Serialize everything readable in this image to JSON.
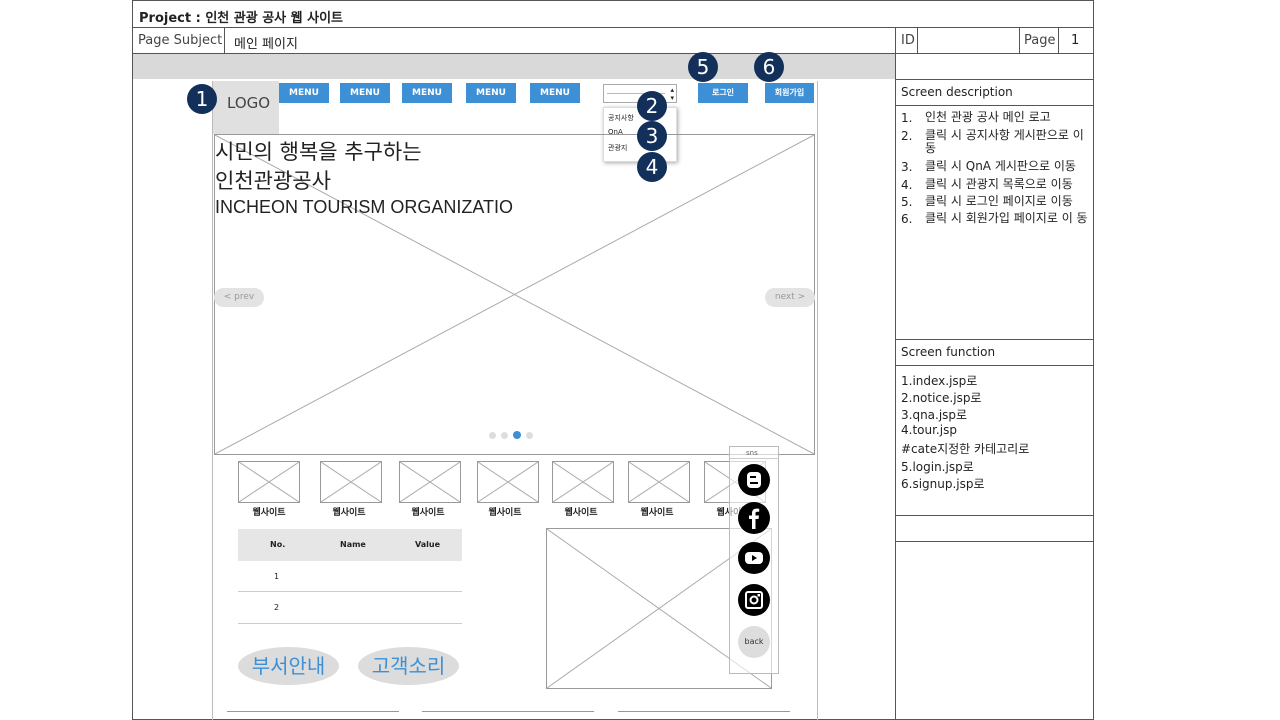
{
  "project": {
    "title": "Project : 인천 관광 공사 웹 사이트"
  },
  "subject": {
    "label": "Page Subject",
    "value": "메인 페이지",
    "id_label": "ID",
    "id_value": "",
    "page_label": "Page",
    "page_value": "1"
  },
  "header": {
    "logo": "LOGO",
    "menus": [
      "MENU",
      "MENU",
      "MENU",
      "MENU",
      "MENU"
    ],
    "login": "로그인",
    "signup": "회원가입"
  },
  "dropdown": {
    "items": [
      "공지사항",
      "QnA",
      "관광지"
    ]
  },
  "badges": [
    "1",
    "2",
    "3",
    "4",
    "5",
    "6"
  ],
  "hero": {
    "line1": "시민의 행복을 추구하는",
    "line2": "인천관광공사",
    "line3": "INCHEON TOURISM ORGANIZATIO",
    "prev": "< prev",
    "next": "next >",
    "dots": 4,
    "active_dot": 3
  },
  "sites": {
    "labels": [
      "웹사이트",
      "웹사이트",
      "웹사이트",
      "웹사이트",
      "웹사이트",
      "웹사이트",
      "웹사이트"
    ]
  },
  "table": {
    "headers": [
      "No.",
      "Name",
      "Value"
    ],
    "rows": [
      [
        "1",
        "",
        ""
      ],
      [
        "2",
        "",
        ""
      ]
    ]
  },
  "buttons": {
    "dept": "부서안내",
    "voice": "고객소리"
  },
  "sns": {
    "label": "sns",
    "icons": [
      "blogger-icon",
      "facebook-icon",
      "youtube-icon",
      "instagram-icon"
    ],
    "back": "back"
  },
  "description": {
    "title": "Screen description",
    "items": [
      {
        "num": "1.",
        "text": "인천 관광 공사 메인 로고"
      },
      {
        "num": "2.",
        "text": "클릭 시 공지사항 게시판으로 이동"
      },
      {
        "num": "3.",
        "text": "클릭 시 QnA 게시판으로 이동"
      },
      {
        "num": "4.",
        "text": "클릭 시 관광지 목록으로 이동"
      },
      {
        "num": "5.",
        "text": "클릭 시 로그인 페이지로 이동"
      },
      {
        "num": "6.",
        "text": "클릭 시 회원가입 페이지로 이 동"
      }
    ]
  },
  "function": {
    "title": "Screen function",
    "lines": [
      "1.index.jsp로",
      "2.notice.jsp로",
      "3.qna.jsp로",
      "4.tour.jsp",
      "#cate지정한 카테고리로",
      "5.login.jsp로",
      "6.signup.jsp로"
    ]
  }
}
